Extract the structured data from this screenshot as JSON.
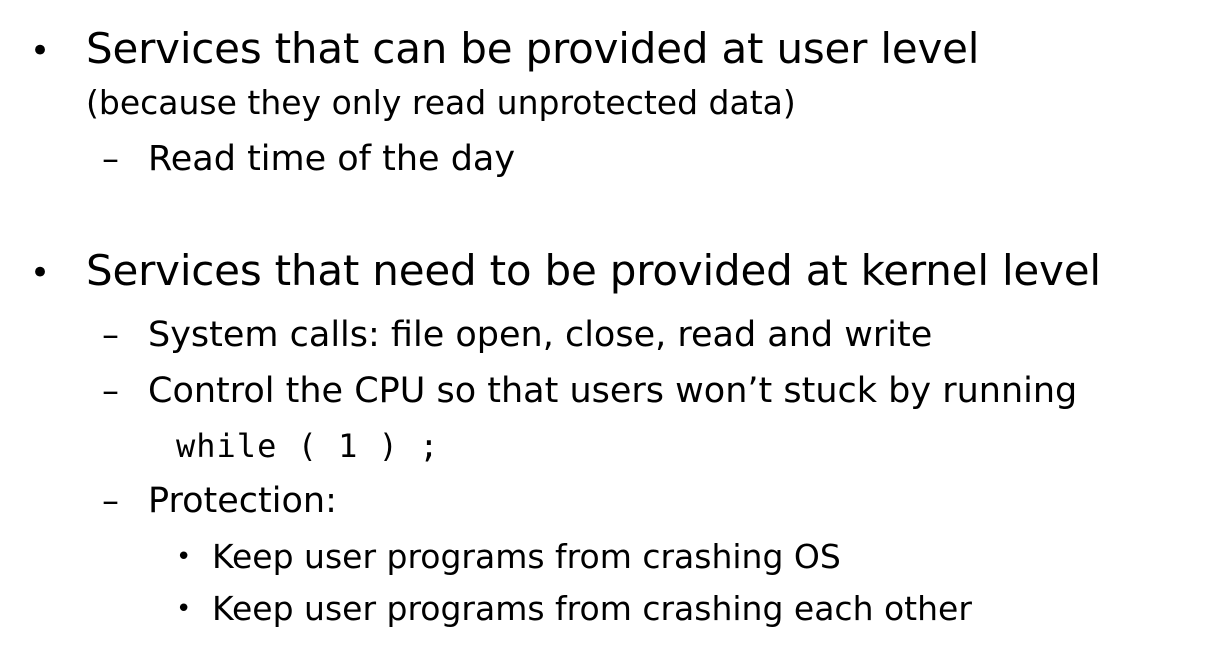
{
  "bullets": {
    "marker": "•",
    "dash": "–",
    "sub_marker": "•"
  },
  "section1": {
    "heading": "Services that can be provided at user level",
    "subheading": "(because they only read unprotected data)",
    "items": [
      "Read time of the day"
    ]
  },
  "section2": {
    "heading": "Services that need to be provided at kernel level",
    "items": [
      "System calls: file open, close, read and write",
      "Control the CPU so that users won’t stuck by running",
      "Protection:"
    ],
    "code": "while ( 1 ) ;",
    "protection_items": [
      "Keep user programs from crashing OS",
      "Keep user programs from crashing each other"
    ]
  }
}
